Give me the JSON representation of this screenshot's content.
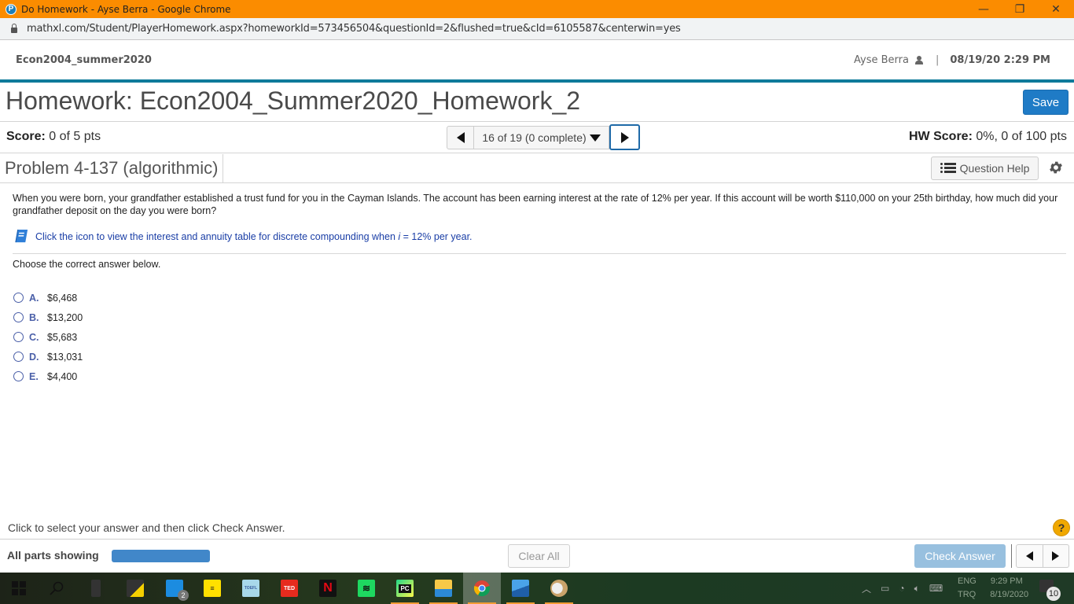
{
  "browser": {
    "window_title": "Do Homework - Ayse Berra - Google Chrome",
    "favicon_letter": "P",
    "url": "mathxl.com/Student/PlayerHomework.aspx?homeworkId=573456504&questionId=2&flushed=true&cId=6105587&centerwin=yes",
    "controls": {
      "minimize": "—",
      "restore": "❐",
      "close": "✕"
    }
  },
  "course_header": {
    "course_name": "Econ2004_summer2020",
    "user_name": "Ayse Berra",
    "separator": "|",
    "datetime": "08/19/20 2:29 PM"
  },
  "homework": {
    "title": "Homework: Econ2004_Summer2020_Homework_2",
    "save_label": "Save"
  },
  "score_bar": {
    "score_label": "Score:",
    "score_value": "0 of 5 pts",
    "pager_text": "16 of 19 (0 complete)",
    "hw_score_label": "HW Score:",
    "hw_score_value": "0%, 0 of 100 pts"
  },
  "problem": {
    "title": "Problem 4-137 (algorithmic)",
    "help_label": "Question Help",
    "question_text": "When you were born, your grandfather established a trust fund for you in the Cayman Islands. The account has been earning interest at the rate of 12% per year. If this account will be worth $110,000 on your 25th birthday, how much did your grandfather deposit on the day you were born?",
    "table_link_prefix": "Click the icon to view the interest and annuity table for discrete compounding when ",
    "table_link_var": "i",
    "table_link_suffix": " = 12% per year.",
    "instruction": "Choose the correct answer below.",
    "choices": [
      {
        "letter": "A.",
        "value": "$6,468"
      },
      {
        "letter": "B.",
        "value": "$13,200"
      },
      {
        "letter": "C.",
        "value": "$5,683"
      },
      {
        "letter": "D.",
        "value": "$13,031"
      },
      {
        "letter": "E.",
        "value": "$4,400"
      }
    ]
  },
  "footer": {
    "instruction": "Click to select your answer and then click Check Answer.",
    "help_glyph": "?",
    "parts_label": "All parts showing",
    "parts_progress": 1.0,
    "clear_label": "Clear All",
    "check_label": "Check Answer"
  },
  "colors": {
    "titlebar": "#fb8c00",
    "accent_rule": "#0e7a9a",
    "primary_button": "#1f7bc6",
    "disabled_button": "#98c0df",
    "choice_letter": "#4a5fa8",
    "link": "#1a3ea6"
  },
  "taskbar": {
    "apps": [
      {
        "name": "start",
        "icon": "windows-icon"
      },
      {
        "name": "search",
        "icon": "search-icon"
      },
      {
        "name": "notebook",
        "icon": "notebook-icon"
      },
      {
        "name": "sticky-notes",
        "icon": "sticky-notes-icon"
      },
      {
        "name": "mail",
        "icon": "mail-icon",
        "badge": "2"
      },
      {
        "name": "notes",
        "icon": "notes-icon"
      },
      {
        "name": "toefl",
        "icon": "toefl-icon",
        "label": "TOEFL"
      },
      {
        "name": "ted",
        "icon": "ted-icon",
        "label": "TED"
      },
      {
        "name": "netflix",
        "icon": "netflix-icon",
        "label": "N"
      },
      {
        "name": "spotify",
        "icon": "spotify-icon"
      },
      {
        "name": "pycharm",
        "icon": "pycharm-icon",
        "label": "PC"
      },
      {
        "name": "file-explorer",
        "icon": "folder-icon"
      },
      {
        "name": "chrome",
        "icon": "chrome-icon"
      },
      {
        "name": "photos",
        "icon": "photos-icon"
      },
      {
        "name": "paint",
        "icon": "paint-icon"
      }
    ],
    "tray": {
      "language_top": "ENG",
      "language_bottom": "TRQ",
      "time": "9:29 PM",
      "date": "8/19/2020",
      "notification_count": "10"
    }
  }
}
